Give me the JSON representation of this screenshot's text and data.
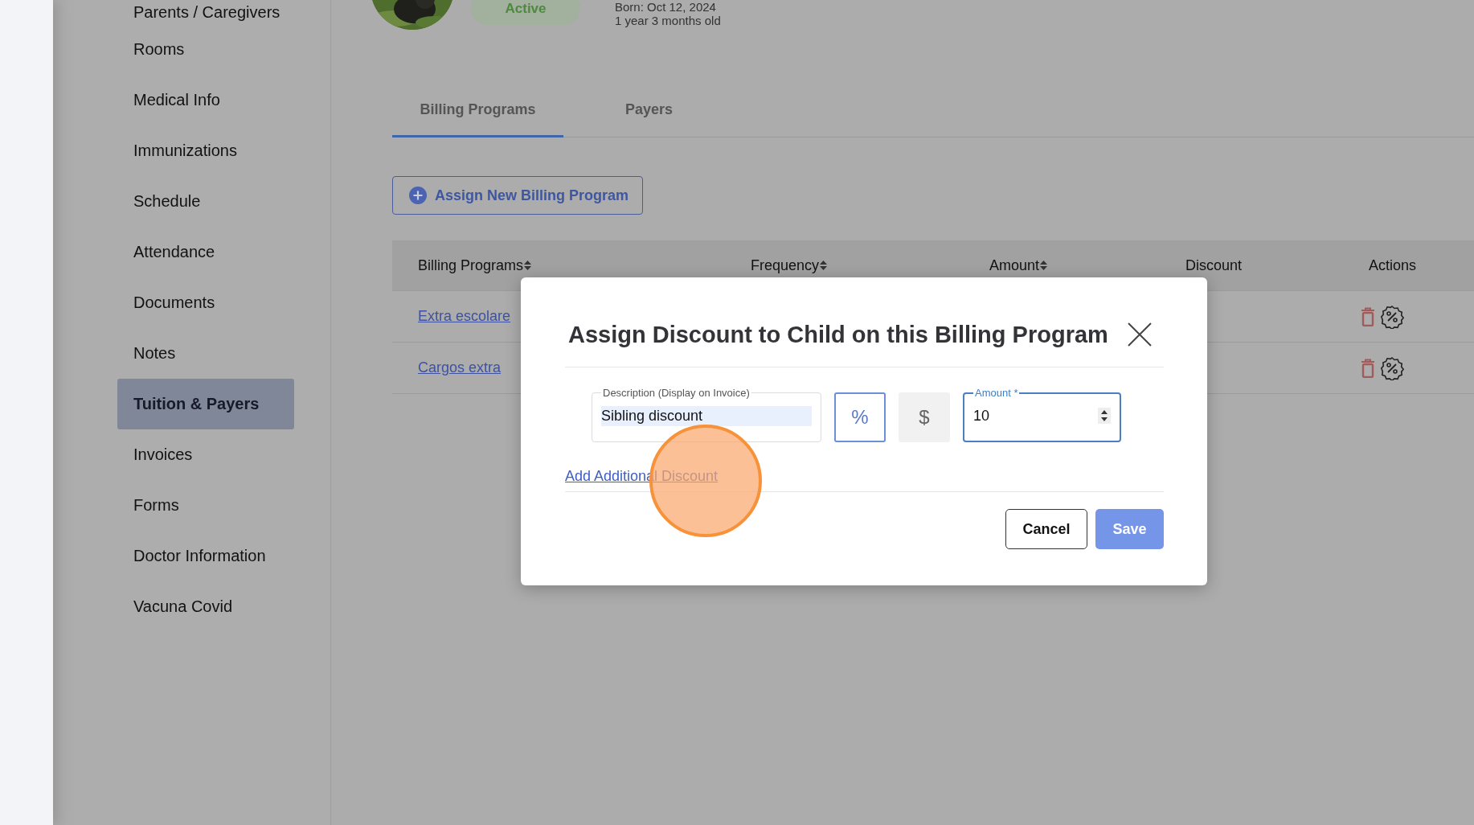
{
  "sidebar": {
    "items": [
      {
        "label": "Parents / Caregivers",
        "selected": false
      },
      {
        "label": "Rooms",
        "selected": false
      },
      {
        "label": "Medical Info",
        "selected": false
      },
      {
        "label": "Immunizations",
        "selected": false
      },
      {
        "label": "Schedule",
        "selected": false
      },
      {
        "label": "Attendance",
        "selected": false
      },
      {
        "label": "Documents",
        "selected": false
      },
      {
        "label": "Notes",
        "selected": false
      },
      {
        "label": "Tuition & Payers",
        "selected": true
      },
      {
        "label": "Invoices",
        "selected": false
      },
      {
        "label": "Forms",
        "selected": false
      },
      {
        "label": "Doctor Information",
        "selected": false
      },
      {
        "label": "Vacuna Covid",
        "selected": false
      }
    ]
  },
  "child": {
    "status": "Active",
    "born": "Born: Oct 12, 2024",
    "age": "1 year 3 months old"
  },
  "tabs": [
    {
      "label": "Billing Programs",
      "selected": true
    },
    {
      "label": "Payers",
      "selected": false
    }
  ],
  "assign_button": "Assign New Billing Program",
  "table": {
    "columns": [
      {
        "label": "Billing Programs",
        "sortable": true
      },
      {
        "label": "Frequency",
        "sortable": true
      },
      {
        "label": "Amount",
        "sortable": true
      },
      {
        "label": "Discount",
        "sortable": false
      },
      {
        "label": "Actions",
        "sortable": false
      }
    ],
    "rows": [
      {
        "program": "Extra escolare"
      },
      {
        "program": "Cargos extra"
      }
    ]
  },
  "dialog": {
    "title": "Assign Discount to Child on this Billing Program",
    "description": {
      "label": "Description (Display on Invoice)",
      "value": "Sibling discount"
    },
    "discount_types": [
      {
        "symbol": "%",
        "selected": true
      },
      {
        "symbol": "$",
        "selected": false
      }
    ],
    "amount": {
      "label": "Amount *",
      "value": "10"
    },
    "add_link": "Add Additional Discount",
    "buttons": [
      {
        "label": "Cancel",
        "kind": "secondary"
      },
      {
        "label": "Save",
        "kind": "primary"
      }
    ]
  }
}
